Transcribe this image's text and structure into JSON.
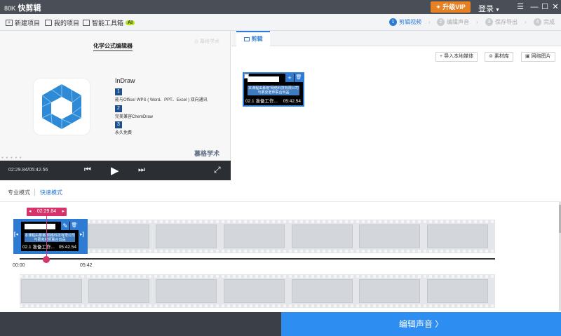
{
  "app": {
    "logo_mark": "80K",
    "logo_text": "快剪辑"
  },
  "titlebar": {
    "vip_label": "✦ 升级VIP",
    "login_label": "登录",
    "menu": "☰",
    "minimize": "—",
    "maximize": "☐",
    "close": "✕"
  },
  "toolbar": {
    "new_project": "新建项目",
    "my_projects": "我的项目",
    "toolbox": "智能工具箱",
    "ai_badge": "AI"
  },
  "steps": [
    {
      "num": "1",
      "label": "剪辑视频",
      "active": true
    },
    {
      "num": "2",
      "label": "编辑声音",
      "active": false
    },
    {
      "num": "3",
      "label": "保存导出",
      "active": false
    },
    {
      "num": "4",
      "label": "完成",
      "active": false
    }
  ],
  "preview": {
    "doc_title": "化学公式编辑器",
    "watermark": "◎ 幕格学术",
    "app_name": "InDraw",
    "features": [
      {
        "num": "1",
        "text": "能与Office/ WPS ( Word、PPT、Excel ) 双向通讯"
      },
      {
        "num": "2",
        "text": "完美兼容ChemDraw"
      },
      {
        "num": "3",
        "text": "永久免费"
      }
    ],
    "brand": "慕格学术",
    "dots": "● ● ● ● ●"
  },
  "player": {
    "time": "02:29.84/05:42.56",
    "prev": "⏮",
    "play": "▶",
    "next": "⏭",
    "fullscreen": "⤢"
  },
  "edit_panel": {
    "tab_label": "剪辑",
    "buttons": [
      {
        "icon": "+",
        "label": "导入本地媒体"
      },
      {
        "icon": "⊜",
        "label": "素材库"
      },
      {
        "icon": "▣",
        "label": "网络图片"
      }
    ]
  },
  "media_clip": {
    "slide_text": "本课程由慕格\"网络科技有限公司与慕克老师联合出品",
    "title": "02.1 准备工作...",
    "duration": "05:42.54",
    "add_icon": "+",
    "delete_icon": "🗑"
  },
  "modes": {
    "pro": "专业模式",
    "quick": "快速模式"
  },
  "timeline": {
    "playhead": "02:29.84",
    "playhead_prev": "◂",
    "playhead_next": "▸",
    "ticks": [
      "00:00",
      "05:42"
    ],
    "clip_title": "02.1 准备工作...",
    "clip_duration": "05:42.54",
    "clip_slide_text": "本课程由慕格\"网络科技有限公司与慕克老师联合出品",
    "edit_icon": "✎",
    "delete_icon": "🗑",
    "handle_left": "[◂",
    "handle_right": "▸]"
  },
  "footer": {
    "next_label": "编辑声音 〉"
  }
}
